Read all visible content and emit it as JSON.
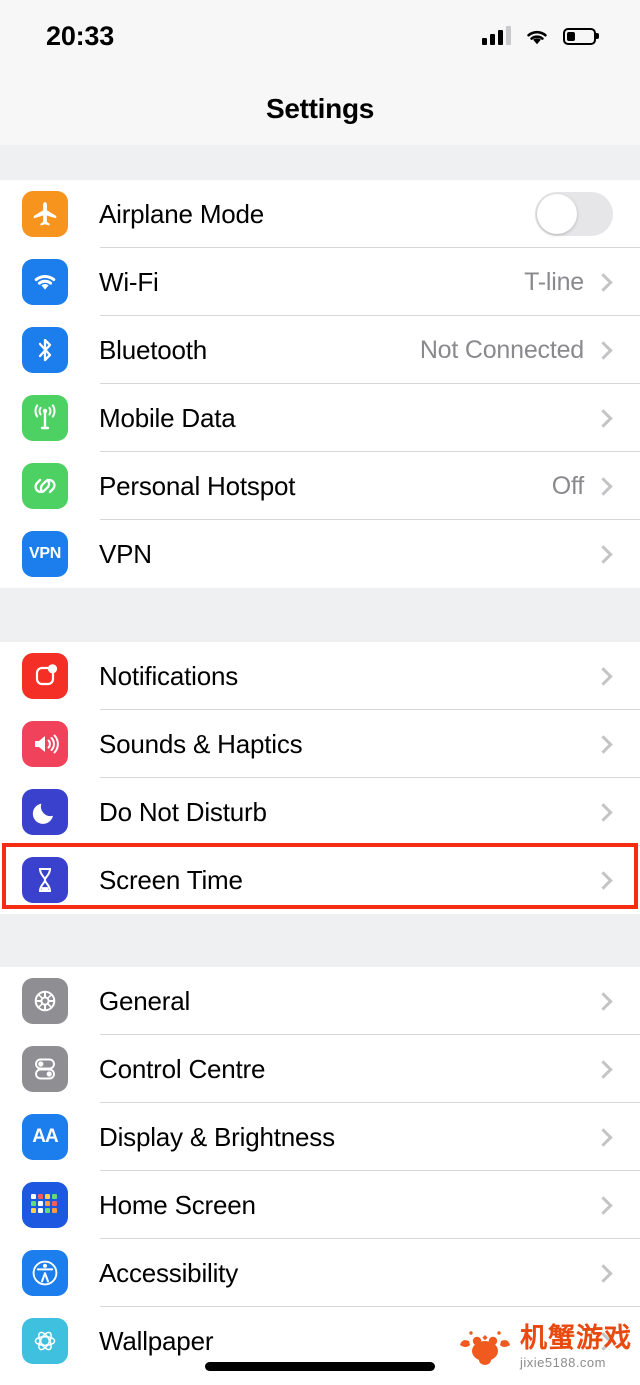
{
  "status_bar": {
    "time": "20:33",
    "signal_icon": "cellular-signal-icon",
    "signal_bars_filled": 3,
    "signal_bars_total": 4,
    "wifi_icon": "wifi-icon",
    "battery_icon": "battery-icon",
    "battery_level_percent": 30
  },
  "nav": {
    "title": "Settings"
  },
  "colors": {
    "highlight": "#f32c13",
    "detail_text": "#8a8a8e",
    "chevron": "#c4c4c7",
    "separator": "#d6d6da",
    "group_gap": "#eff0f2",
    "airplane": "#f7941d",
    "wifi": "#1c7ded",
    "bluetooth": "#1c7ded",
    "mobile_data": "#4cd162",
    "hotspot": "#4cd162",
    "vpn": "#1c7ded",
    "notifications": "#f42f25",
    "sounds": "#f0425a",
    "do_not_disturb": "#3a41cc",
    "screen_time": "#3a41cc",
    "general": "#8e8e93",
    "control_centre": "#8e8e93",
    "display": "#1c7ded",
    "home_screen": "#1c58e0",
    "accessibility": "#1c7ded",
    "wallpaper": "#3ec0de"
  },
  "sections": [
    {
      "name": "connectivity",
      "rows": [
        {
          "label": "Airplane Mode",
          "icon": "airplane-icon",
          "accessory": "toggle",
          "toggle_on": false,
          "detail": ""
        },
        {
          "label": "Wi-Fi",
          "icon": "wifi-icon",
          "accessory": "chevron",
          "detail": "T-line"
        },
        {
          "label": "Bluetooth",
          "icon": "bluetooth-icon",
          "accessory": "chevron",
          "detail": "Not Connected"
        },
        {
          "label": "Mobile Data",
          "icon": "mobile-data-icon",
          "accessory": "chevron",
          "detail": ""
        },
        {
          "label": "Personal Hotspot",
          "icon": "personal-hotspot-icon",
          "accessory": "chevron",
          "detail": "Off"
        },
        {
          "label": "VPN",
          "icon": "vpn-icon",
          "accessory": "chevron",
          "detail": ""
        }
      ]
    },
    {
      "name": "alerts",
      "rows": [
        {
          "label": "Notifications",
          "icon": "notifications-icon",
          "accessory": "chevron",
          "detail": ""
        },
        {
          "label": "Sounds & Haptics",
          "icon": "sounds-haptics-icon",
          "accessory": "chevron",
          "detail": ""
        },
        {
          "label": "Do Not Disturb",
          "icon": "do-not-disturb-icon",
          "accessory": "chevron",
          "detail": ""
        },
        {
          "label": "Screen Time",
          "icon": "screen-time-icon",
          "accessory": "chevron",
          "detail": "",
          "highlighted": true
        }
      ]
    },
    {
      "name": "system",
      "rows": [
        {
          "label": "General",
          "icon": "general-gear-icon",
          "accessory": "chevron",
          "detail": ""
        },
        {
          "label": "Control Centre",
          "icon": "control-centre-icon",
          "accessory": "chevron",
          "detail": ""
        },
        {
          "label": "Display & Brightness",
          "icon": "display-brightness-icon",
          "accessory": "chevron",
          "detail": ""
        },
        {
          "label": "Home Screen",
          "icon": "home-screen-icon",
          "accessory": "chevron",
          "detail": ""
        },
        {
          "label": "Accessibility",
          "icon": "accessibility-icon",
          "accessory": "chevron",
          "detail": ""
        },
        {
          "label": "Wallpaper",
          "icon": "wallpaper-icon",
          "accessory": "chevron",
          "detail": ""
        }
      ]
    }
  ],
  "watermark": {
    "brand": "机蟹游戏",
    "url": "jixie5188.com",
    "logo_icon": "crab-logo-icon"
  }
}
